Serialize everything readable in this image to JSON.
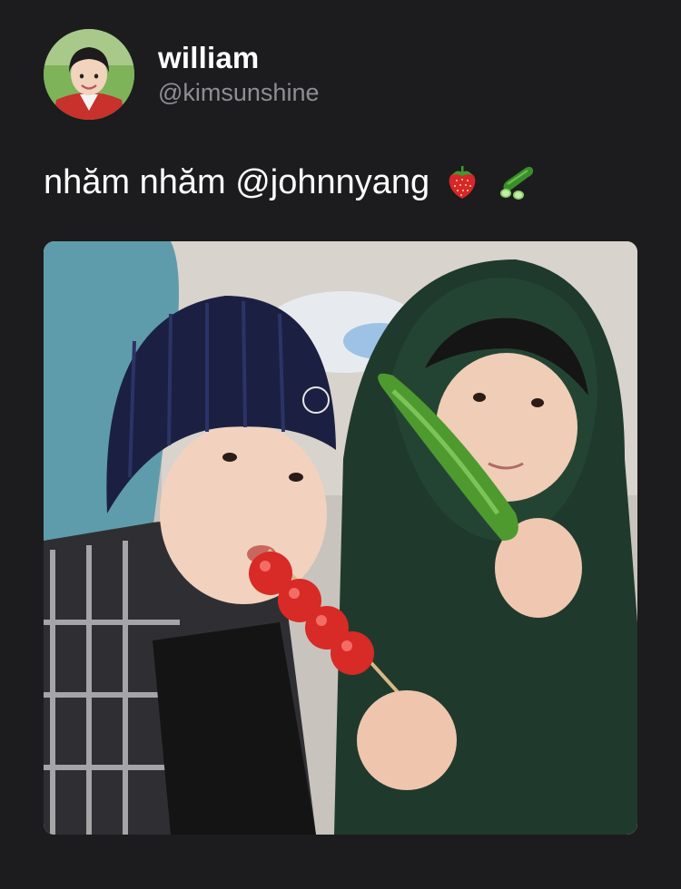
{
  "tweet": {
    "author": {
      "display_name": "william",
      "handle": "@kimsunshine",
      "avatar_icon": "profile-photo-avatar"
    },
    "text": "nhăm nhăm @johnnyang",
    "emojis": [
      "strawberry-icon",
      "cucumber-icon"
    ],
    "media": {
      "type": "photo",
      "icon": "photo-two-people-eating-tanghulu-and-cucumber"
    }
  },
  "colors": {
    "background": "#1c1c1e",
    "text_primary": "#ffffff",
    "text_secondary": "#8e8e93"
  }
}
